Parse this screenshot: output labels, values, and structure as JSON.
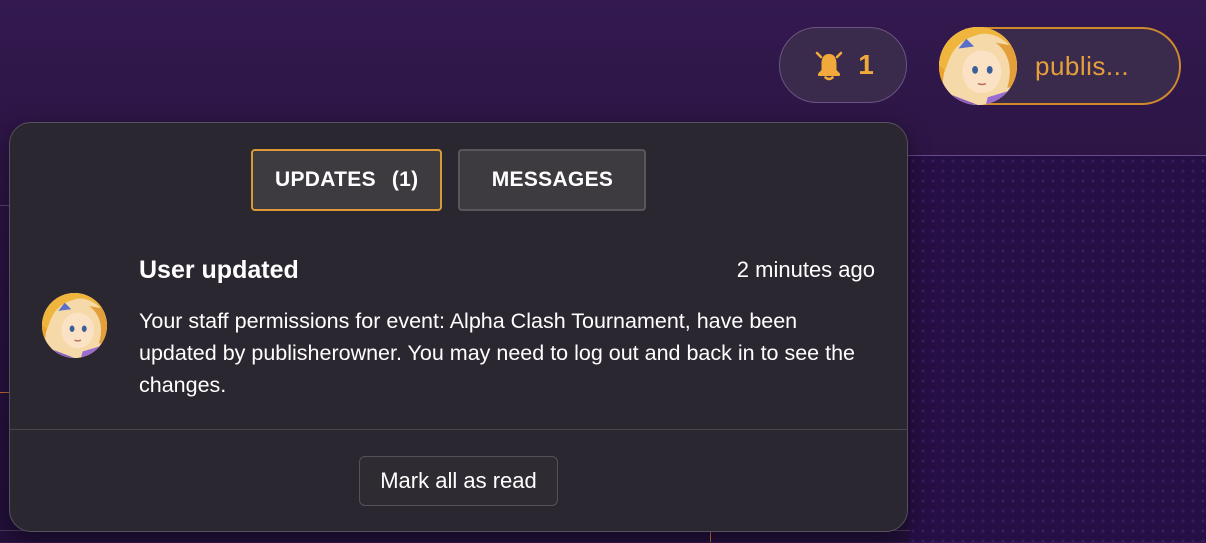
{
  "header": {
    "notifications": {
      "icon": "bell-icon",
      "count": "1"
    },
    "user": {
      "name": "publis...",
      "avatar": "avatar-icon"
    }
  },
  "panel": {
    "tabs": [
      {
        "label": "UPDATES",
        "count": "(1)",
        "active": true
      },
      {
        "label": "MESSAGES",
        "active": false
      }
    ],
    "notifications": [
      {
        "title": "User updated",
        "time": "2 minutes ago",
        "body": "Your staff permissions for event: Alpha Clash Tournament, have been updated by publisherowner. You may need to log out and back in to see the changes.",
        "avatar": "avatar-icon"
      }
    ],
    "mark_all_label": "Mark all as read"
  },
  "colors": {
    "accent": "#f0a93a",
    "user_border": "#d08a2d",
    "active_tab_border": "#d99a35",
    "panel_bg": "#2b2730",
    "page_bg": "#2a1342"
  }
}
